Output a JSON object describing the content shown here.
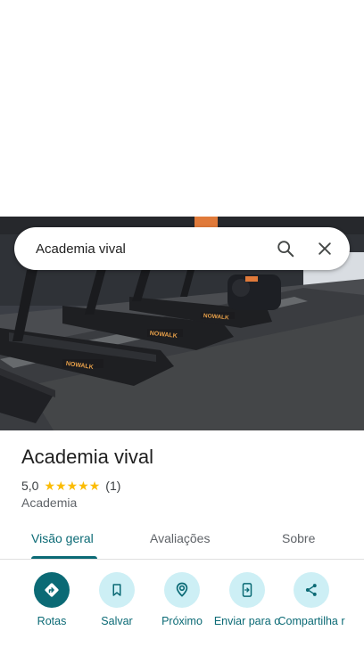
{
  "search": {
    "query": "Academia vival",
    "search_icon": "search-icon",
    "close_icon": "close-icon"
  },
  "place": {
    "name": "Academia vival",
    "rating": "5,0",
    "stars": 5,
    "review_count": "(1)",
    "category": "Academia",
    "photo_brand_text": "NOWALK"
  },
  "tabs": [
    {
      "label": "Visão geral",
      "active": true
    },
    {
      "label": "Avaliações",
      "active": false
    },
    {
      "label": "Sobre",
      "active": false
    }
  ],
  "actions": [
    {
      "label": "Rotas",
      "icon": "directions-icon"
    },
    {
      "label": "Salvar",
      "icon": "bookmark-icon"
    },
    {
      "label": "Próximo",
      "icon": "nearby-icon"
    },
    {
      "label": "Enviar para o",
      "icon": "send-to-phone-icon"
    },
    {
      "label": "Compartilha r",
      "icon": "share-icon"
    }
  ],
  "colors": {
    "accent": "#0b6a75",
    "accent_light": "#cdeff5",
    "star": "#fbbc04",
    "text_primary": "#1f1f1f",
    "text_secondary": "#5f6368"
  }
}
